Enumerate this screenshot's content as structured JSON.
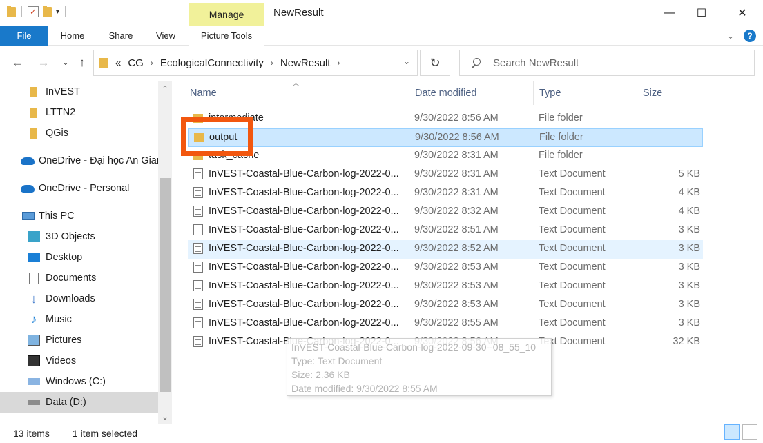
{
  "window": {
    "title": "NewResult",
    "manage_label": "Manage",
    "minimize": "—",
    "maximize": "☐",
    "close": "✕"
  },
  "ribbon": {
    "tabs": [
      "File",
      "Home",
      "Share",
      "View",
      "Picture Tools"
    ],
    "help": "?"
  },
  "address": {
    "overflow": "«",
    "path": [
      "CG",
      "EcologicalConnectivity",
      "NewResult"
    ]
  },
  "search": {
    "placeholder": "Search NewResult"
  },
  "nav_pane": {
    "items": [
      {
        "label": "InVEST",
        "icon": "folder-icon"
      },
      {
        "label": "LTTN2",
        "icon": "folder-icon"
      },
      {
        "label": "QGis",
        "icon": "folder-icon"
      },
      {
        "label": "OneDrive - Đại học An Giang",
        "icon": "onedrive-icon"
      },
      {
        "label": "OneDrive - Personal",
        "icon": "onedrive-icon"
      },
      {
        "label": "This PC",
        "icon": "computer-icon"
      },
      {
        "label": "3D Objects",
        "icon": "3d-objects-icon"
      },
      {
        "label": "Desktop",
        "icon": "desktop-icon"
      },
      {
        "label": "Documents",
        "icon": "documents-icon"
      },
      {
        "label": "Downloads",
        "icon": "downloads-icon"
      },
      {
        "label": "Music",
        "icon": "music-icon"
      },
      {
        "label": "Pictures",
        "icon": "pictures-icon"
      },
      {
        "label": "Videos",
        "icon": "videos-icon"
      },
      {
        "label": "Windows (C:)",
        "icon": "windows-drive-icon"
      },
      {
        "label": "Data (D:)",
        "icon": "drive-icon"
      }
    ]
  },
  "columns": {
    "name": "Name",
    "date": "Date modified",
    "type": "Type",
    "size": "Size"
  },
  "files": [
    {
      "name": "intermediate",
      "date": "9/30/2022 8:56 AM",
      "type": "File folder",
      "size": "",
      "kind": "folder"
    },
    {
      "name": "output",
      "date": "9/30/2022 8:56 AM",
      "type": "File folder",
      "size": "",
      "kind": "folder"
    },
    {
      "name": "task_cache",
      "date": "9/30/2022 8:31 AM",
      "type": "File folder",
      "size": "",
      "kind": "folder"
    },
    {
      "name": "InVEST-Coastal-Blue-Carbon-log-2022-0...",
      "date": "9/30/2022 8:31 AM",
      "type": "Text Document",
      "size": "5 KB",
      "kind": "txt"
    },
    {
      "name": "InVEST-Coastal-Blue-Carbon-log-2022-0...",
      "date": "9/30/2022 8:31 AM",
      "type": "Text Document",
      "size": "4 KB",
      "kind": "txt"
    },
    {
      "name": "InVEST-Coastal-Blue-Carbon-log-2022-0...",
      "date": "9/30/2022 8:32 AM",
      "type": "Text Document",
      "size": "4 KB",
      "kind": "txt"
    },
    {
      "name": "InVEST-Coastal-Blue-Carbon-log-2022-0...",
      "date": "9/30/2022 8:51 AM",
      "type": "Text Document",
      "size": "3 KB",
      "kind": "txt"
    },
    {
      "name": "InVEST-Coastal-Blue-Carbon-log-2022-0...",
      "date": "9/30/2022 8:52 AM",
      "type": "Text Document",
      "size": "3 KB",
      "kind": "txt"
    },
    {
      "name": "InVEST-Coastal-Blue-Carbon-log-2022-0...",
      "date": "9/30/2022 8:53 AM",
      "type": "Text Document",
      "size": "3 KB",
      "kind": "txt"
    },
    {
      "name": "InVEST-Coastal-Blue-Carbon-log-2022-0...",
      "date": "9/30/2022 8:53 AM",
      "type": "Text Document",
      "size": "3 KB",
      "kind": "txt"
    },
    {
      "name": "InVEST-Coastal-Blue-Carbon-log-2022-0...",
      "date": "9/30/2022 8:53 AM",
      "type": "Text Document",
      "size": "3 KB",
      "kind": "txt"
    },
    {
      "name": "InVEST-Coastal-Blue-Carbon-log-2022-0...",
      "date": "9/30/2022 8:55 AM",
      "type": "Text Document",
      "size": "3 KB",
      "kind": "txt"
    },
    {
      "name": "InVEST-Coastal-Blue-Carbon-log-2022-0...",
      "date": "9/30/2022 8:56 AM",
      "type": "Text Document",
      "size": "32 KB",
      "kind": "txt"
    }
  ],
  "tooltip": {
    "name": "InVEST-Coastal-Blue-Carbon-log-2022-09-30--08_55_10",
    "type": "Type: Text Document",
    "size": "Size: 2.36 KB",
    "modified": "Date modified: 9/30/2022 8:55 AM"
  },
  "status": {
    "count": "13 items",
    "selected": "1 item selected"
  },
  "colors": {
    "accent": "#1979ca",
    "selection": "#cce8ff",
    "highlight": "#f2570f",
    "manage": "#f1f19a"
  }
}
